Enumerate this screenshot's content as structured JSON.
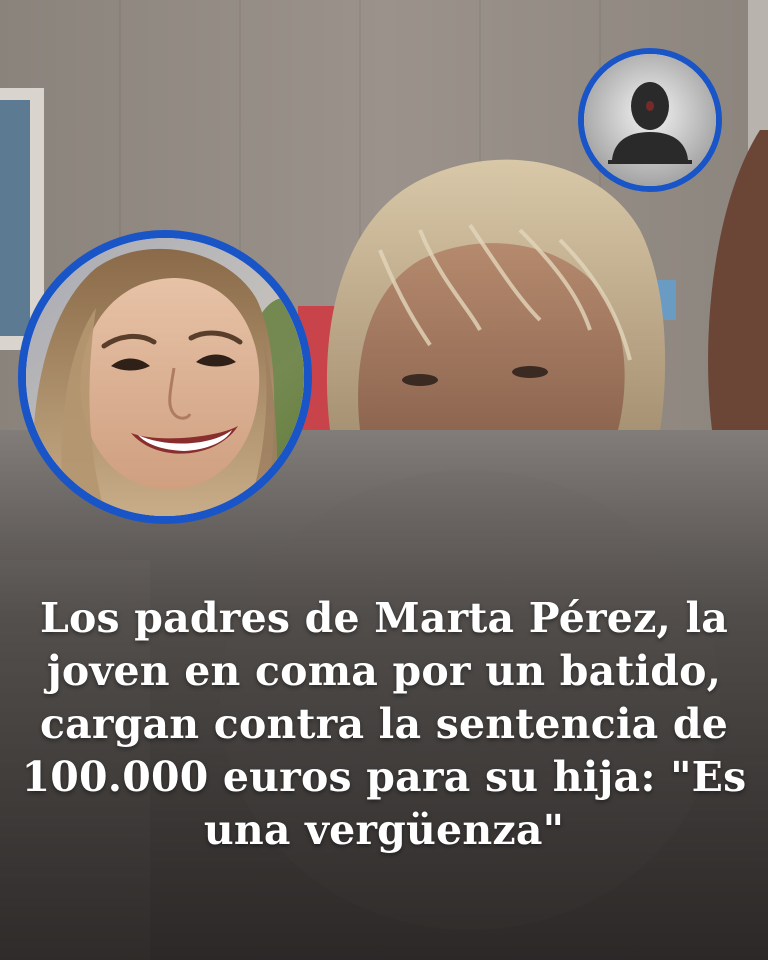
{
  "headline": {
    "text": "Los padres de Marta Pérez, la joven en coma por un batido, cargan contra la sentencia de 100.000 euros para su hija: \"Es una vergüenza\""
  },
  "portraits": {
    "main": {
      "icon": "smiling-young-woman-photo"
    },
    "small": {
      "icon": "anonymous-person-silhouette-icon"
    }
  },
  "colors": {
    "ring": "#1a55c8",
    "headline_text": "#ffffff"
  }
}
